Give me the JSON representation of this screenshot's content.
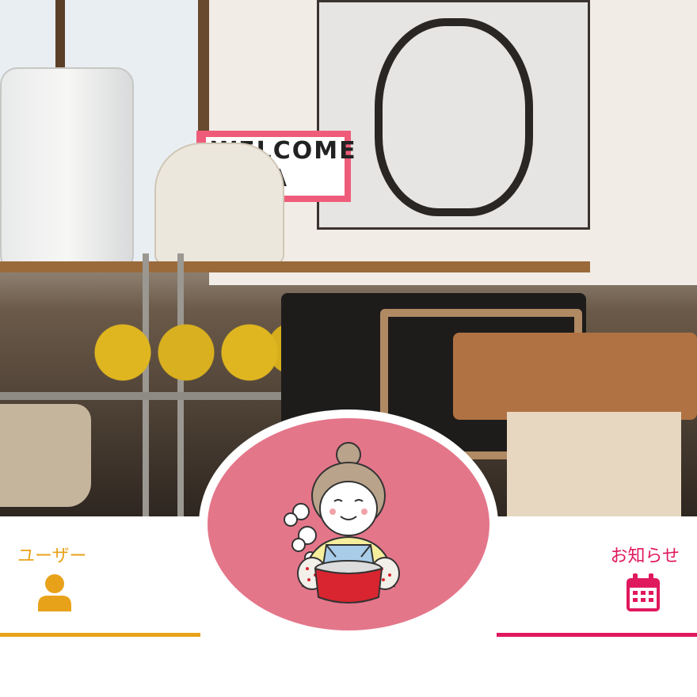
{
  "hero": {
    "sign_text": "WELCOME CASA"
  },
  "nav": {
    "user": {
      "label": "ユーザー",
      "icon": "user-icon",
      "color": "#e8a21a"
    },
    "news": {
      "label": "お知らせ",
      "icon": "calendar-icon",
      "color": "#e0185e"
    }
  },
  "logo": {
    "icon": "cooking-grandma-logo",
    "background": "#e4768a"
  }
}
